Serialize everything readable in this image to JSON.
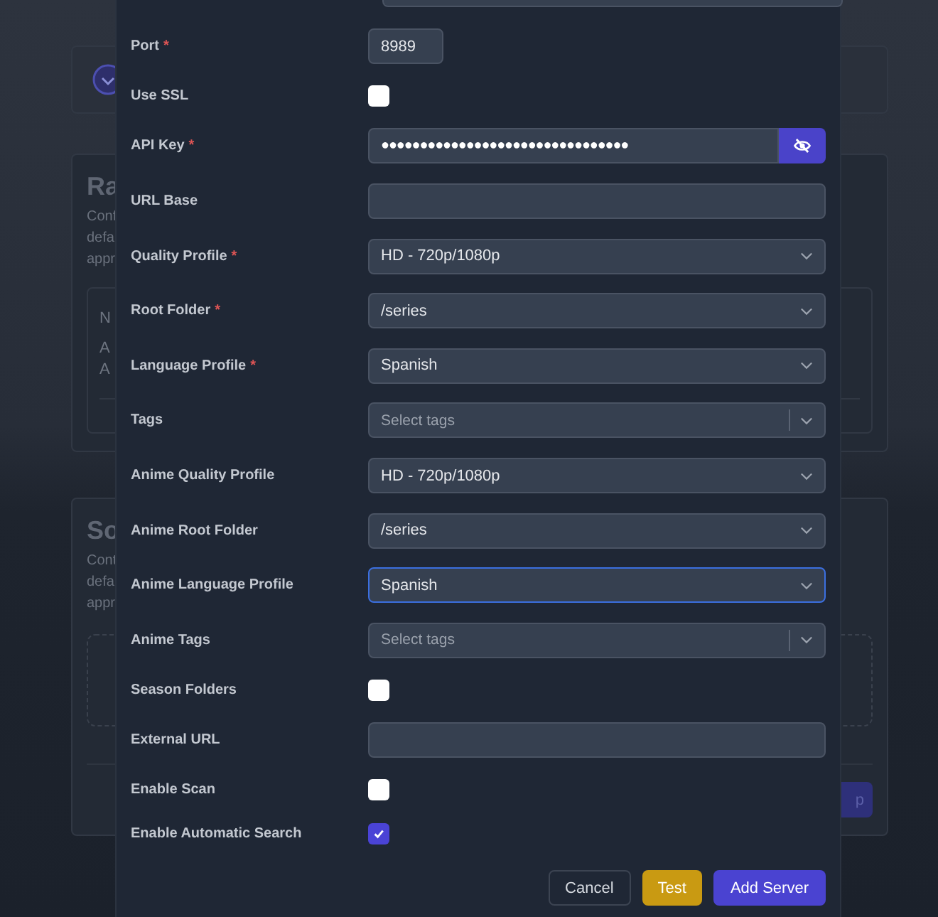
{
  "background": {
    "cards": [
      {
        "kind": "avatar"
      },
      {
        "kind": "list",
        "heading": "Ra",
        "description": [
          "Conf",
          "defa",
          "appr"
        ],
        "items": [
          "N",
          "A",
          "A"
        ]
      },
      {
        "kind": "dropzone",
        "heading": "So",
        "description": [
          "Cont",
          "defa",
          "appr"
        ],
        "button": "p"
      }
    ]
  },
  "modal": {
    "fields": [
      {
        "label": "Port",
        "required_mark": "*",
        "kind": "number",
        "value": "8989"
      },
      {
        "label": "Use SSL",
        "kind": "checkbox",
        "checked": false
      },
      {
        "label": "API Key",
        "required_mark": "*",
        "kind": "password",
        "value": "●●●●●●●●●●●●●●●●●●●●●●●●●●●●●●●●"
      },
      {
        "label": "URL Base",
        "kind": "text"
      },
      {
        "label": "Quality Profile",
        "required_mark": "*",
        "kind": "select",
        "value": "HD - 720p/1080p",
        "focused": false
      },
      {
        "label": "Root Folder",
        "required_mark": "*",
        "kind": "select",
        "value": "/series",
        "focused": false
      },
      {
        "label": "Language Profile",
        "required_mark": "*",
        "kind": "select",
        "value": "Spanish",
        "focused": false
      },
      {
        "label": "Tags",
        "kind": "tags",
        "placeholder": "Select tags"
      },
      {
        "label": "Anime Quality Profile",
        "kind": "select",
        "value": "HD - 720p/1080p",
        "focused": false
      },
      {
        "label": "Anime Root Folder",
        "kind": "select",
        "value": "/series",
        "focused": false
      },
      {
        "label": "Anime Language Profile",
        "kind": "select",
        "value": "Spanish",
        "focused": true
      },
      {
        "label": "Anime Tags",
        "kind": "tags",
        "placeholder": "Select tags"
      },
      {
        "label": "Season Folders",
        "kind": "checkbox",
        "checked": false
      },
      {
        "label": "External URL",
        "kind": "text"
      },
      {
        "label": "Enable Scan",
        "kind": "checkbox",
        "checked": false
      },
      {
        "label": "Enable Automatic Search",
        "kind": "checkbox",
        "checked": true
      }
    ],
    "buttons": [
      {
        "label": "Cancel",
        "kind": "secondary"
      },
      {
        "label": "Test",
        "kind": "warning"
      },
      {
        "label": "Add Server",
        "kind": "primary"
      }
    ]
  }
}
